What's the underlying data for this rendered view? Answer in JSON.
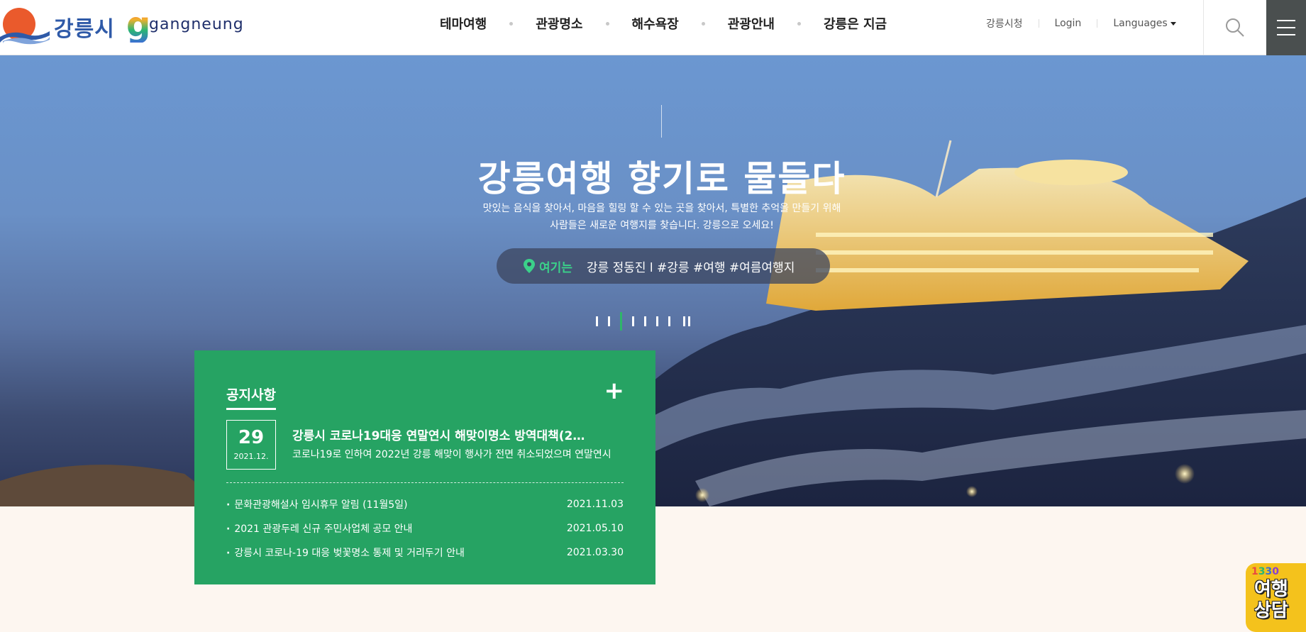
{
  "header": {
    "logo_ko": "강릉시",
    "logo_en_letter": "g",
    "logo_en_word": "gangneung",
    "nav": [
      {
        "label": "테마여행"
      },
      {
        "label": "관광명소"
      },
      {
        "label": "해수욕장"
      },
      {
        "label": "관광안내"
      },
      {
        "label": "강릉은 지금"
      }
    ],
    "util": {
      "city_hall": "강릉시청",
      "login": "Login",
      "languages": "Languages"
    }
  },
  "hero": {
    "title": "강릉여행 향기로 물들다",
    "desc_line1": "맛있는 음식을 찾아서, 마음을 힐링 할 수 있는 곳을 찾아서, 특별한 추억을 만들기 위해",
    "desc_line2": "사람들은 새로운 여행지를 찾습니다. 강릉으로 오세요!",
    "pill_label": "여기는",
    "pill_text": "강릉 정동진 l  #강릉 #여행 #여름여행지",
    "slides_total": 7,
    "slide_active": 3
  },
  "notice": {
    "title": "공지사항",
    "more": "+",
    "featured": {
      "day": "29",
      "year_month": "2021.12.",
      "title": "강릉시 코로나19대응 연말연시 해맞이명소 방역대책(2…",
      "desc": "코로나19로 인하여 2022년 강릉 해맞이 행사가 전면 취소되었으며 연말연시"
    },
    "items": [
      {
        "title": "문화관광해설사 임시휴무 알림 (11월5일)",
        "date": "2021.11.03"
      },
      {
        "title": "2021 관광두레 신규 주민사업체 공모 안내",
        "date": "2021.05.10"
      },
      {
        "title": "강릉시 코로나-19 대응 벚꽃명소 통제 및 거리두기 안내",
        "date": "2021.03.30"
      }
    ]
  },
  "consult": {
    "number_digits": [
      "1",
      "3",
      "3",
      "0"
    ],
    "line1": "여행",
    "line2": "상담"
  },
  "colors": {
    "notice_green": "#26a363",
    "menu_dark": "#4a4f4f",
    "pill_accent": "#3bd18a",
    "badge_yellow": "#f4c21c",
    "logo_blue": "#2f5aa8",
    "logo_sun": "#ea5a2c"
  },
  "icons": [
    "search-icon",
    "hamburger-menu-icon",
    "location-pin-icon",
    "pause-icon",
    "plus-icon",
    "caret-down-icon"
  ]
}
